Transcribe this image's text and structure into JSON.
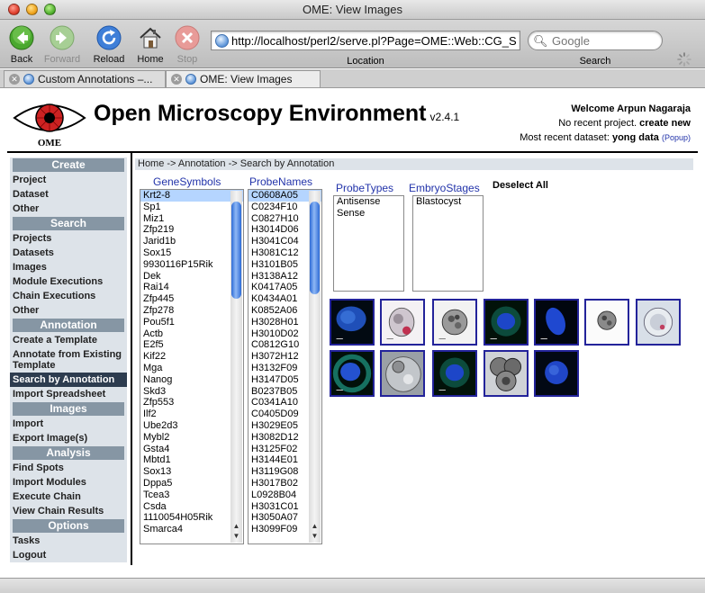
{
  "window": {
    "title": "OME: View Images"
  },
  "toolbar": {
    "back_label": "Back",
    "forward_label": "Forward",
    "reload_label": "Reload",
    "home_label": "Home",
    "stop_label": "Stop",
    "url_value": "http://localhost/perl2/serve.pl?Page=OME::Web::CG_S",
    "location_label": "Location",
    "search_placeholder": "Google",
    "search_label": "Search"
  },
  "tabs": [
    {
      "label": "Custom Annotations –..."
    },
    {
      "label": "OME: View Images"
    }
  ],
  "header": {
    "logo_text": "OME",
    "brand": "Open Microscopy Environment",
    "version": "v2.4.1",
    "welcome": "Welcome Arpun Nagaraja",
    "project_status": "No recent project.",
    "create_new": "create new",
    "dataset_prefix": "Most recent dataset:",
    "dataset_name": "yong data",
    "popup": "(Popup)"
  },
  "sidebar": {
    "sections": [
      {
        "title": "Create",
        "items": [
          "Project",
          "Dataset",
          "Other"
        ]
      },
      {
        "title": "Search",
        "items": [
          "Projects",
          "Datasets",
          "Images",
          "Module Executions",
          "Chain Executions",
          "Other"
        ]
      },
      {
        "title": "Annotation",
        "items": [
          "Create a Template",
          "Annotate from Existing Template",
          "Search by Annotation",
          "Import Spreadsheet"
        ]
      },
      {
        "title": "Images",
        "items": [
          "Import",
          "Export Image(s)"
        ]
      },
      {
        "title": "Analysis",
        "items": [
          "Find Spots",
          "Import Modules",
          "Execute Chain",
          "View Chain Results"
        ]
      },
      {
        "title": "Options",
        "items": [
          "Tasks",
          "Logout"
        ]
      }
    ],
    "active_item": "Search by Annotation"
  },
  "main": {
    "breadcrumb": "Home -> Annotation -> Search by Annotation",
    "gene_header": "GeneSymbols",
    "probe_header": "ProbeNames",
    "probetypes_header": "ProbeTypes",
    "embryo_header": "EmbryoStages",
    "deselect_all": "Deselect All",
    "gene_symbols": [
      "Krt2-8",
      "Sp1",
      "Miz1",
      "Zfp219",
      "Jarid1b",
      "Sox15",
      "9930116P15Rik",
      "Dek",
      "Rai14",
      "Zfp445",
      "Zfp278",
      "Pou5f1",
      "Actb",
      "E2f5",
      "Kif22",
      "Mga",
      "Nanog",
      "Skd3",
      "Zfp553",
      "Ilf2",
      "Ube2d3",
      "Mybl2",
      "Gsta4",
      "Mbtd1",
      "Sox13",
      "Dppa5",
      "Tcea3",
      "Csda",
      "1110054H05Rik",
      "Smarca4"
    ],
    "probe_names": [
      "C0608A05",
      "C0234F10",
      "C0827H10",
      "H3014D06",
      "H3041C04",
      "H3081C12",
      "H3101B05",
      "H3138A12",
      "K0417A05",
      "K0434A01",
      "K0852A06",
      "H3028H01",
      "H3010D02",
      "C0812G10",
      "H3072H12",
      "H3132F09",
      "H3147D05",
      "B0237B05",
      "C0341A10",
      "C0405D09",
      "H3029E05",
      "H3082D12",
      "H3125F02",
      "H3144E01",
      "H3119G08",
      "H3017B02",
      "L0928B04",
      "H3031C01",
      "H3050A07",
      "H3099F09"
    ],
    "probe_types": [
      "Antisense",
      "Sense"
    ],
    "embryo_stages": [
      "Blastocyst"
    ],
    "thumbnails": [
      {
        "kind": "fluor-blob"
      },
      {
        "kind": "brightfield-pink"
      },
      {
        "kind": "brightfield-cell"
      },
      {
        "kind": "fluor-cell"
      },
      {
        "kind": "fluor-oval"
      },
      {
        "kind": "brightfield-small"
      },
      {
        "kind": "brightfield-light"
      },
      {
        "kind": "fluor-ring"
      },
      {
        "kind": "brightfield-embryo"
      },
      {
        "kind": "fluor-cell"
      },
      {
        "kind": "brightfield-cluster"
      },
      {
        "kind": "fluor-round"
      }
    ]
  }
}
